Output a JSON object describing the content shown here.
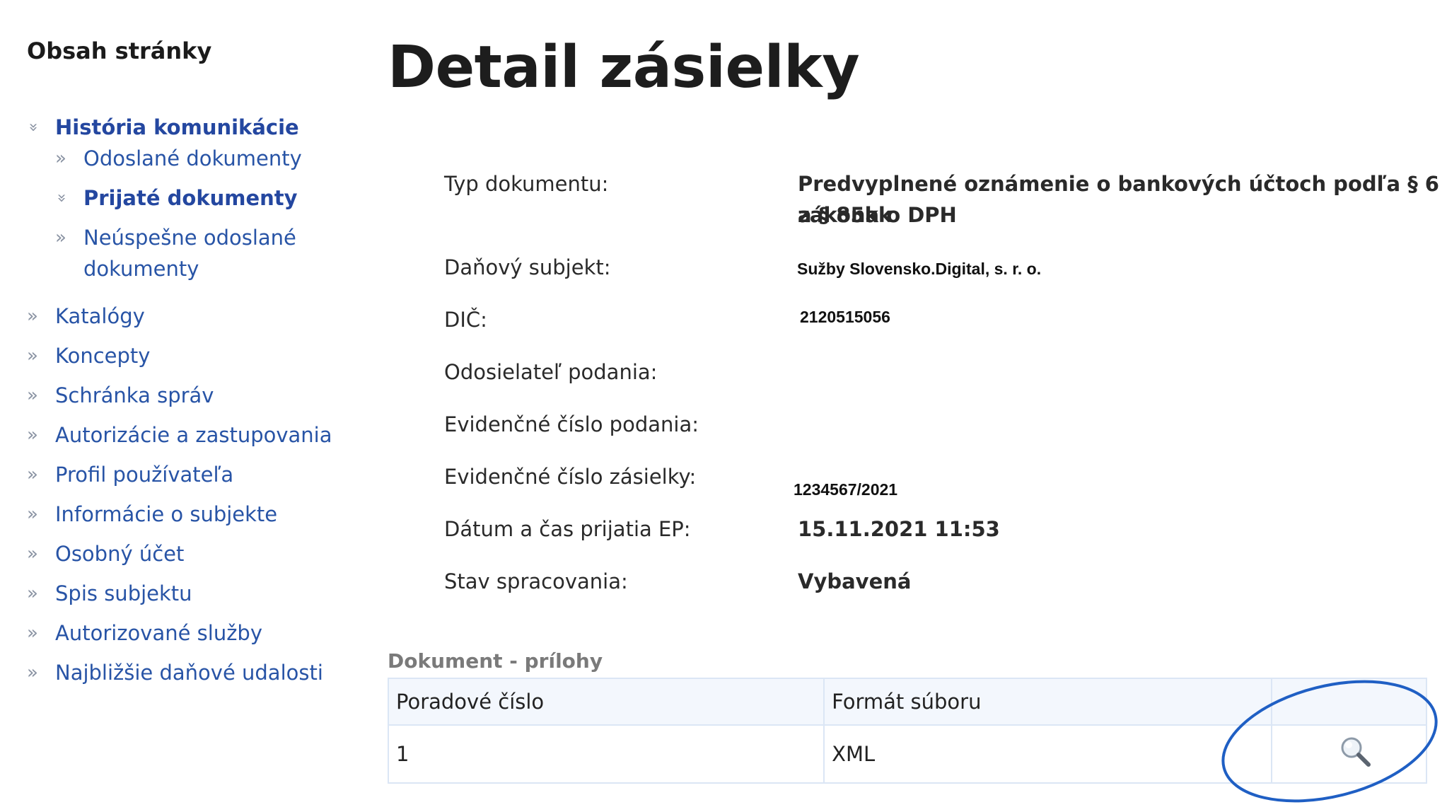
{
  "sidebar": {
    "heading": "Obsah stránky",
    "items": [
      {
        "label": "História komunikácie"
      },
      {
        "label": "Odoslané dokumenty"
      },
      {
        "label": "Prijaté dokumenty"
      },
      {
        "label_line1": "Neúspešne odoslané",
        "label_line2": "dokumenty"
      },
      {
        "label": "Katalógy"
      },
      {
        "label": "Koncepty"
      },
      {
        "label": "Schránka správ"
      },
      {
        "label": "Autorizácie a zastupovania"
      },
      {
        "label": "Profil používateľa"
      },
      {
        "label": "Informácie o subjekte"
      },
      {
        "label": "Osobný účet"
      },
      {
        "label": "Spis subjektu"
      },
      {
        "label": "Autorizované služby"
      },
      {
        "label": "Najbližšie daňové udalosti"
      }
    ]
  },
  "main": {
    "title": "Detail zásielky",
    "fields": {
      "typ_dokumentu": {
        "label": "Typ dokumentu:",
        "value_line1": "Predvyplnené oznámenie o bankových účtoch podľa § 6 a § 85kk",
        "value_line2": "zákona o DPH"
      },
      "danovy_subjekt": {
        "label": "Daňový subjekt:",
        "value": "Sužby Slovensko.Digital, s. r. o."
      },
      "dic": {
        "label": "DIČ:",
        "value": "2120515056"
      },
      "odosielatel": {
        "label": "Odosielateľ podania:",
        "value": ""
      },
      "ev_cislo_podania": {
        "label": "Evidenčné číslo podania:",
        "value": ""
      },
      "ev_cislo_zasielky": {
        "label": "Evidenčné číslo zásielky:",
        "value": "1234567/2021"
      },
      "datum_prijatia": {
        "label": "Dátum a čas prijatia EP:",
        "value": "15.11.2021 11:53"
      },
      "stav": {
        "label": "Stav spracovania:",
        "value": "Vybavená"
      }
    },
    "attachments": {
      "title": "Dokument - prílohy",
      "columns": [
        "Poradové číslo",
        "Formát súboru",
        ""
      ],
      "rows": [
        {
          "number": "1",
          "format": "XML",
          "action_icon": "magnifier-icon"
        }
      ]
    }
  },
  "colors": {
    "link": "#2854a6",
    "highlight_ellipse": "#1f5fc4",
    "table_border": "#dbe6f5"
  }
}
